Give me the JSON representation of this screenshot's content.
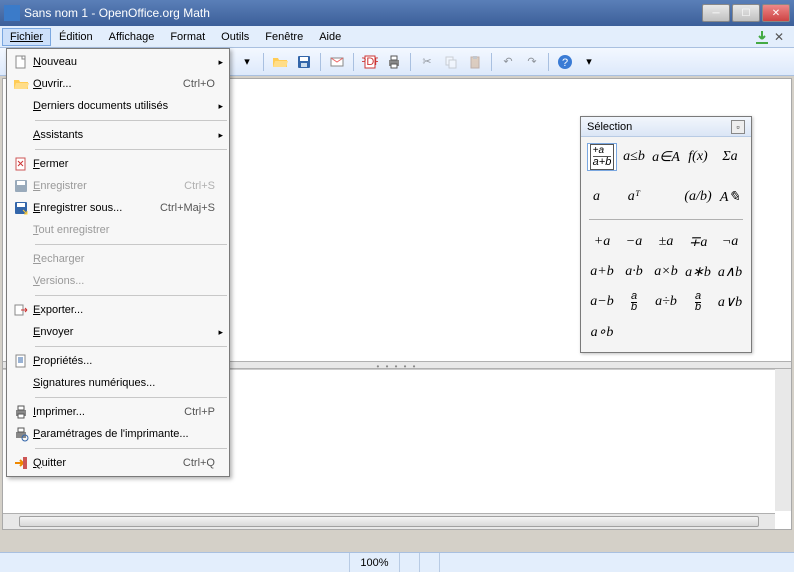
{
  "window": {
    "title": "Sans nom 1 - OpenOffice.org Math"
  },
  "menubar": [
    "Fichier",
    "Édition",
    "Affichage",
    "Format",
    "Outils",
    "Fenêtre",
    "Aide"
  ],
  "file_menu": {
    "items": [
      {
        "icon": "doc-new",
        "label": "Nouveau",
        "accel": "",
        "submenu": true,
        "disabled": false
      },
      {
        "icon": "folder-open",
        "label": "Ouvrir...",
        "accel": "Ctrl+O",
        "submenu": false,
        "disabled": false
      },
      {
        "icon": "",
        "label": "Derniers documents utilisés",
        "accel": "",
        "submenu": true,
        "disabled": false
      },
      {
        "sep": true
      },
      {
        "icon": "",
        "label": "Assistants",
        "accel": "",
        "submenu": true,
        "disabled": false
      },
      {
        "sep": true
      },
      {
        "icon": "doc-close",
        "label": "Fermer",
        "accel": "",
        "submenu": false,
        "disabled": false
      },
      {
        "icon": "save",
        "label": "Enregistrer",
        "accel": "Ctrl+S",
        "submenu": false,
        "disabled": true
      },
      {
        "icon": "saveas",
        "label": "Enregistrer sous...",
        "accel": "Ctrl+Maj+S",
        "submenu": false,
        "disabled": false
      },
      {
        "icon": "",
        "label": "Tout enregistrer",
        "accel": "",
        "submenu": false,
        "disabled": true
      },
      {
        "sep": true
      },
      {
        "icon": "",
        "label": "Recharger",
        "accel": "",
        "submenu": false,
        "disabled": true
      },
      {
        "icon": "",
        "label": "Versions...",
        "accel": "",
        "submenu": false,
        "disabled": true
      },
      {
        "sep": true
      },
      {
        "icon": "export",
        "label": "Exporter...",
        "accel": "",
        "submenu": false,
        "disabled": false
      },
      {
        "icon": "",
        "label": "Envoyer",
        "accel": "",
        "submenu": true,
        "disabled": false
      },
      {
        "sep": true
      },
      {
        "icon": "properties",
        "label": "Propriétés...",
        "accel": "",
        "submenu": false,
        "disabled": false
      },
      {
        "icon": "",
        "label": "Signatures numériques...",
        "accel": "",
        "submenu": false,
        "disabled": false
      },
      {
        "sep": true
      },
      {
        "icon": "print",
        "label": "Imprimer...",
        "accel": "Ctrl+P",
        "submenu": false,
        "disabled": false
      },
      {
        "icon": "printer-settings",
        "label": "Paramétrages de l'imprimante...",
        "accel": "",
        "submenu": false,
        "disabled": false
      },
      {
        "sep": true
      },
      {
        "icon": "exit",
        "label": "Quitter",
        "accel": "Ctrl+Q",
        "submenu": false,
        "disabled": false
      }
    ]
  },
  "palette": {
    "title": "Sélection",
    "top_row": [
      "+a/a+b",
      "a≤b",
      "a∈A",
      "f(x)",
      "Σa"
    ],
    "second_row": [
      "a⃗",
      "aᵀ",
      "",
      "(a/b)",
      "A✎"
    ],
    "ops": [
      [
        "+a",
        "−a",
        "±a",
        "∓a",
        "¬a"
      ],
      [
        "a+b",
        "a·b",
        "a×b",
        "a∗b",
        "a∧b"
      ],
      [
        "a−b",
        "a/b",
        "a÷b",
        "a/b",
        "a∨b"
      ],
      [
        "a∘b",
        "",
        "",
        "",
        ""
      ]
    ]
  },
  "status": {
    "zoom": "100%"
  },
  "splitter_handle": "• • • • •"
}
